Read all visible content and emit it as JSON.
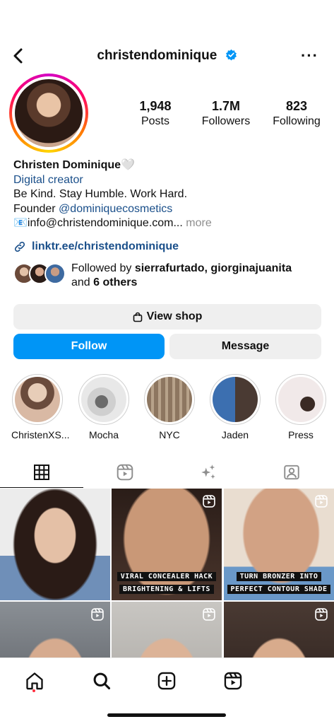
{
  "header": {
    "username": "christendominique",
    "verified": true,
    "back_icon": "chevron-left-icon",
    "more_label": "···"
  },
  "stats": [
    {
      "value": "1,948",
      "label": "Posts"
    },
    {
      "value": "1.7M",
      "label": "Followers"
    },
    {
      "value": "823",
      "label": "Following"
    }
  ],
  "bio": {
    "name": "Christen Dominique",
    "heart": "🤍",
    "category": "Digital creator",
    "line1": "Be Kind. Stay Humble. Work Hard.",
    "founder_prefix": "Founder ",
    "founder_handle": "@dominiquecosmetics",
    "email_icon": "📧",
    "email": "info@christendominique.com...",
    "more": " more"
  },
  "link": {
    "text": "linktr.ee/christendominique",
    "icon": "link-icon"
  },
  "followed_by": {
    "prefix": "Followed by ",
    "names": "sierrafurtado, giorginajuanita",
    "and": "and ",
    "others": "6 others"
  },
  "buttons": {
    "view_shop": "View shop",
    "follow": "Follow",
    "message": "Message"
  },
  "highlights": [
    {
      "label": "ChristenXS...",
      "color": "#d9b9a4"
    },
    {
      "label": "Mocha",
      "color": "#b9b9b9"
    },
    {
      "label": "NYC",
      "color": "#a58f78"
    },
    {
      "label": "Jaden",
      "color": "#6e8fb0"
    },
    {
      "label": "Press",
      "color": "#efe6e6"
    }
  ],
  "tabs": [
    {
      "icon": "grid-icon",
      "active": true
    },
    {
      "icon": "reels-icon",
      "active": false
    },
    {
      "icon": "sparkles-icon",
      "active": false
    },
    {
      "icon": "tagged-icon",
      "active": false
    }
  ],
  "posts": [
    {
      "caption": [],
      "reel": false
    },
    {
      "caption": [
        "VIRAL CONCEALER HACK",
        "BRIGHTENING & LIFTS"
      ],
      "reel": true
    },
    {
      "caption": [
        "TURN BRONZER INTO",
        "PERFECT CONTOUR SHADE"
      ],
      "reel": true
    },
    {
      "caption": [],
      "reel": true
    },
    {
      "caption": [],
      "reel": true
    },
    {
      "caption": [],
      "reel": true
    }
  ],
  "nav": [
    "home-icon",
    "search-icon",
    "create-icon",
    "reels-icon"
  ],
  "colors": {
    "accent": "#0095f6",
    "link": "#1a4f8a",
    "button_gray": "#efefef"
  }
}
